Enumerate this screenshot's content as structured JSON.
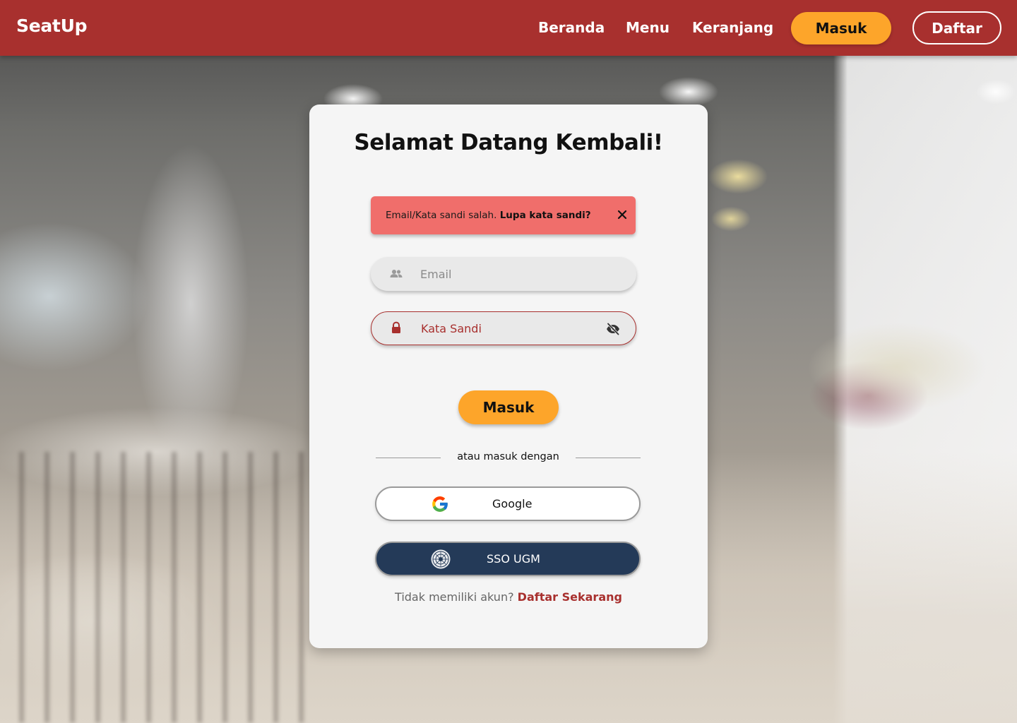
{
  "navbar": {
    "brand": "SeatUp",
    "links": [
      "Beranda",
      "Menu",
      "Keranjang"
    ],
    "login_label": "Masuk",
    "register_label": "Daftar",
    "color": "#a8302e"
  },
  "login_card": {
    "title": "Selamat Datang Kembali!",
    "alert": {
      "message": "Email/Kata sandi salah.",
      "link": "Lupa kata sandi?",
      "color": "#f06e6b"
    },
    "email": {
      "placeholder": "Email",
      "value": "",
      "icon": "users-icon"
    },
    "password": {
      "placeholder": "Kata Sandi",
      "value": "",
      "icon": "lock-icon",
      "toggle_icon": "eye-off-icon"
    },
    "submit_label": "Masuk",
    "divider_text": "atau masuk dengan",
    "google_label": "Google",
    "sso_label": "SSO UGM",
    "signup_prompt": "Tidak memiliki akun?",
    "signup_link": "Daftar Sekarang"
  },
  "colors": {
    "accent": "#fda52a",
    "sso": "#243a58"
  }
}
